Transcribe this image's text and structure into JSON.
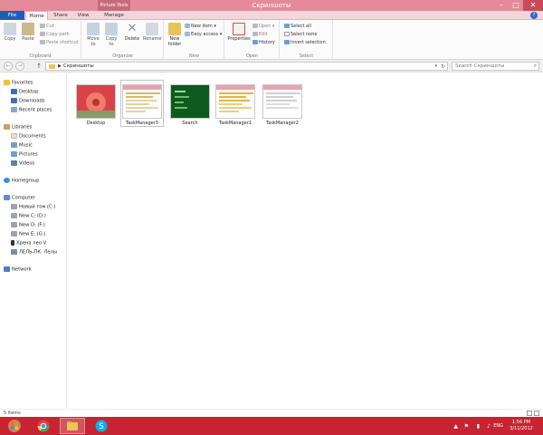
{
  "window": {
    "title": "Скриншоты",
    "context_tab": "Picture Tools",
    "controls": [
      "–",
      "□",
      "✕"
    ]
  },
  "tabs": {
    "file": "File",
    "home": "Home",
    "share": "Share",
    "view": "View",
    "manage": "Manage",
    "help": "?"
  },
  "ribbon": {
    "clipboard": {
      "label": "Clipboard",
      "copy": "Copy",
      "paste": "Paste",
      "cut": "Cut",
      "copy_path": "Copy path",
      "paste_shortcut": "Paste shortcut"
    },
    "organize": {
      "label": "Organize",
      "move_to": "Move to",
      "copy_to": "Copy to",
      "delete": "Delete",
      "rename": "Rename"
    },
    "new": {
      "label": "New",
      "new_folder": "New folder",
      "new_item": "New item ▾",
      "easy_access": "Easy access ▾"
    },
    "open": {
      "label": "Open",
      "properties": "Properties",
      "open": "Open ▾",
      "edit": "Edit",
      "history": "History"
    },
    "select": {
      "label": "Select",
      "select_all": "Select all",
      "select_none": "Select none",
      "invert_selection": "Invert selection"
    }
  },
  "address": {
    "crumb": "Скриншоты",
    "search_placeholder": "Search Скриншоты"
  },
  "nav": {
    "favorites": "Favorites",
    "desktop": "Desktop",
    "downloads": "Downloads",
    "recent": "Recent places",
    "libraries": "Libraries",
    "documents": "Documents",
    "music": "Music",
    "pictures": "Pictures",
    "videos": "Videos",
    "homegroup": "Homegroup",
    "computer": "Computer",
    "drive_c": "Новый том (C:)",
    "drive_d": "New C: (D:)",
    "drive_f": "New D: (F:)",
    "drive_g": "New E: (G:)",
    "phone": "Хрена лео V",
    "network_pc": "ЛЕЛЬ-ПК: Лелы",
    "network": "Network"
  },
  "files": [
    {
      "name": "Desktop"
    },
    {
      "name": "TaskManager3"
    },
    {
      "name": "Search"
    },
    {
      "name": "TaskManager1"
    },
    {
      "name": "TaskManager2"
    }
  ],
  "status": {
    "count": "5 items"
  },
  "tray": {
    "lang": "ENG",
    "time": "1:56 PM",
    "date": "3/11/2012"
  }
}
